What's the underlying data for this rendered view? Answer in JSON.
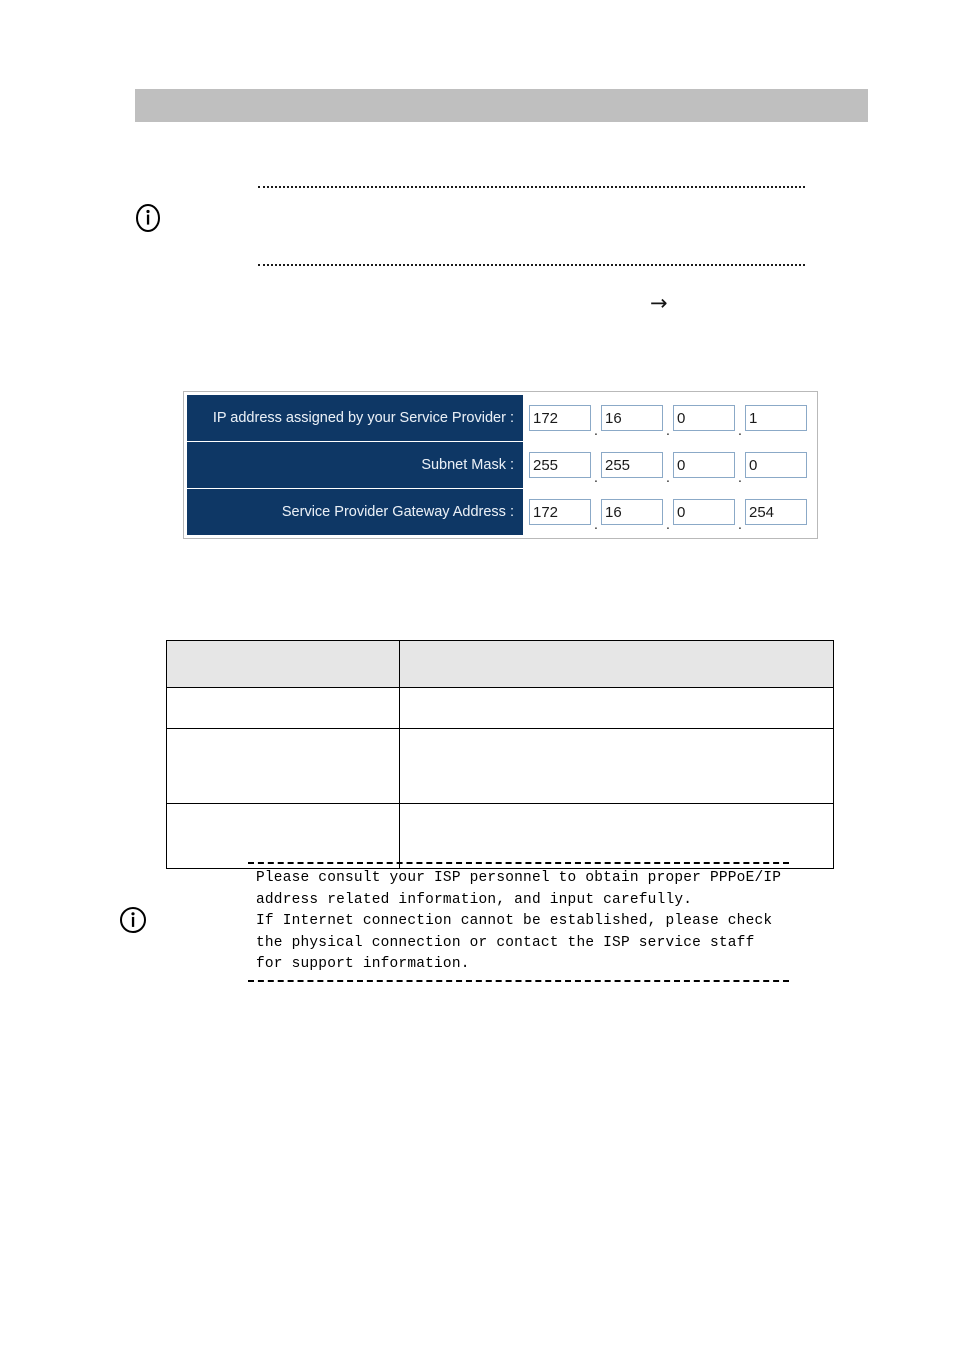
{
  "page": {
    "header_bar_color": "#bfbfbf",
    "background": "#ffffff"
  },
  "note_top": {
    "icon": "info-icon",
    "text": ""
  },
  "arrow": {
    "glyph": "→"
  },
  "config_form": {
    "title": "",
    "label_bg": "#0e3765",
    "label_color": "#e8eef5",
    "input_border": "#8ba9c7",
    "separator": ".",
    "rows": [
      {
        "label": "IP address assigned by your Service Provider :",
        "octets": [
          "172",
          "16",
          "0",
          "1"
        ]
      },
      {
        "label": "Subnet Mask :",
        "octets": [
          "255",
          "255",
          "0",
          "0"
        ]
      },
      {
        "label": "Service Provider Gateway Address :",
        "octets": [
          "172",
          "16",
          "0",
          "254"
        ]
      }
    ]
  },
  "desc_table": {
    "header_bg": "#e6e6e6",
    "columns": [
      "",
      ""
    ],
    "rows": [
      [
        "",
        ""
      ],
      [
        "",
        ""
      ],
      [
        "",
        ""
      ]
    ]
  },
  "note_bottom": {
    "icon": "info-icon",
    "text": "Please consult your ISP personnel to obtain proper PPPoE/IP\naddress related information, and input carefully.\nIf Internet connection cannot be established, please check\nthe physical connection or contact the ISP service staff\nfor support information."
  }
}
